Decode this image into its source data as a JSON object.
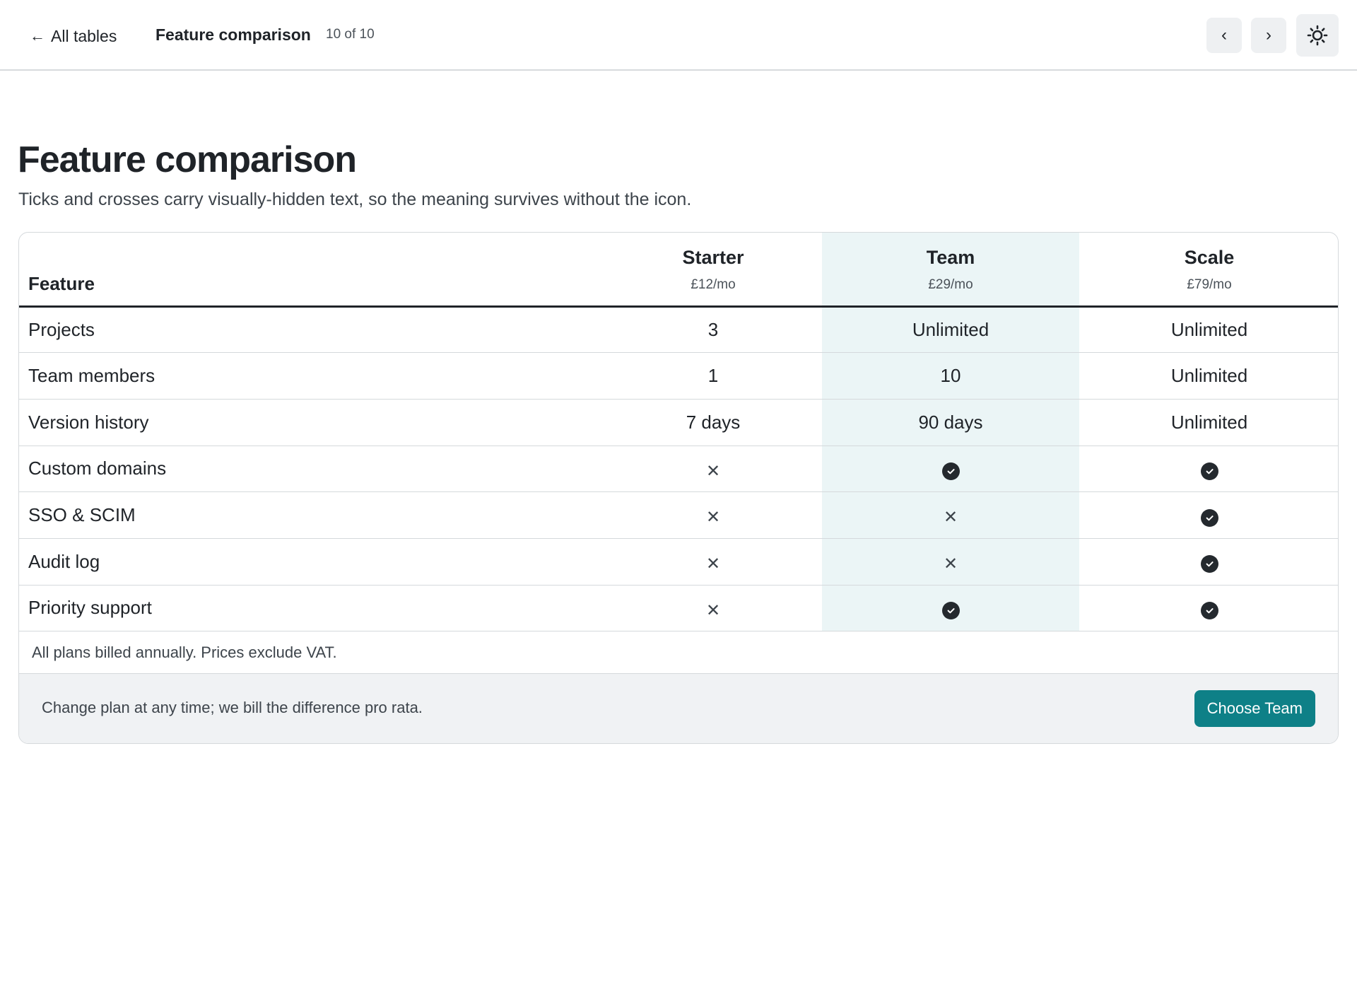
{
  "topbar": {
    "back_label": "All tables",
    "title": "Feature comparison",
    "count": "10 of 10",
    "prev_label": "‹",
    "next_label": "›"
  },
  "page": {
    "title": "Feature comparison",
    "subtitle": "Ticks and crosses carry visually-hidden text, so the meaning survives without the icon."
  },
  "table": {
    "feature_header": "Feature",
    "plans": [
      {
        "name": "Starter",
        "price": "£12/mo"
      },
      {
        "name": "Team",
        "price": "£29/mo"
      },
      {
        "name": "Scale",
        "price": "£79/mo"
      }
    ],
    "rows": [
      {
        "feature": "Projects",
        "values": [
          "3",
          "Unlimited",
          "Unlimited"
        ]
      },
      {
        "feature": "Team members",
        "values": [
          "1",
          "10",
          "Unlimited"
        ]
      },
      {
        "feature": "Version history",
        "values": [
          "7 days",
          "90 days",
          "Unlimited"
        ]
      },
      {
        "feature": "Custom domains",
        "values": [
          "cross-icon",
          "check-icon",
          "check-icon"
        ]
      },
      {
        "feature": "SSO & SCIM",
        "values": [
          "cross-icon",
          "cross-icon",
          "check-icon"
        ]
      },
      {
        "feature": "Audit log",
        "values": [
          "cross-icon",
          "cross-icon",
          "check-icon"
        ]
      },
      {
        "feature": "Priority support",
        "values": [
          "cross-icon",
          "check-icon",
          "check-icon"
        ]
      }
    ],
    "note": "All plans billed annually. Prices exclude VAT."
  },
  "footer": {
    "text": "Change plan at any time; we bill the difference pro rata.",
    "cta_label": "Choose Team"
  },
  "colors": {
    "accent": "#0e8087",
    "highlight_column": "#ebf5f6",
    "text": "#1f2328"
  }
}
